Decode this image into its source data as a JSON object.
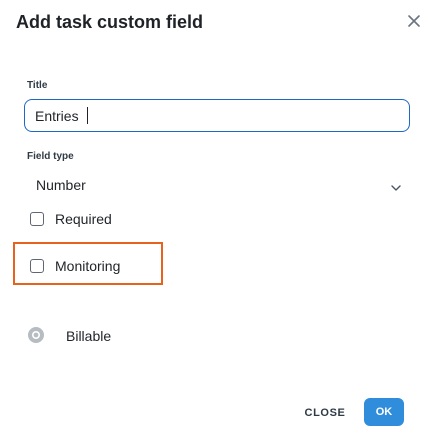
{
  "dialog": {
    "title": "Add task custom field",
    "close_icon": "close-icon"
  },
  "form": {
    "title_label": "Title",
    "title_value": "Entries",
    "field_type_label": "Field type",
    "field_type_value": "Number",
    "field_type_icon": "chevron-down-icon",
    "required_label": "Required",
    "required_checked": false,
    "monitoring_label": "Monitoring",
    "monitoring_checked": false,
    "billable_label": "Billable",
    "billable_icon": "billable-icon"
  },
  "footer": {
    "close_label": "CLOSE",
    "ok_label": "OK"
  },
  "colors": {
    "accent": "#2f8ddc",
    "input_focus_border": "#1e68c8",
    "highlight_border": "#e8621f"
  }
}
